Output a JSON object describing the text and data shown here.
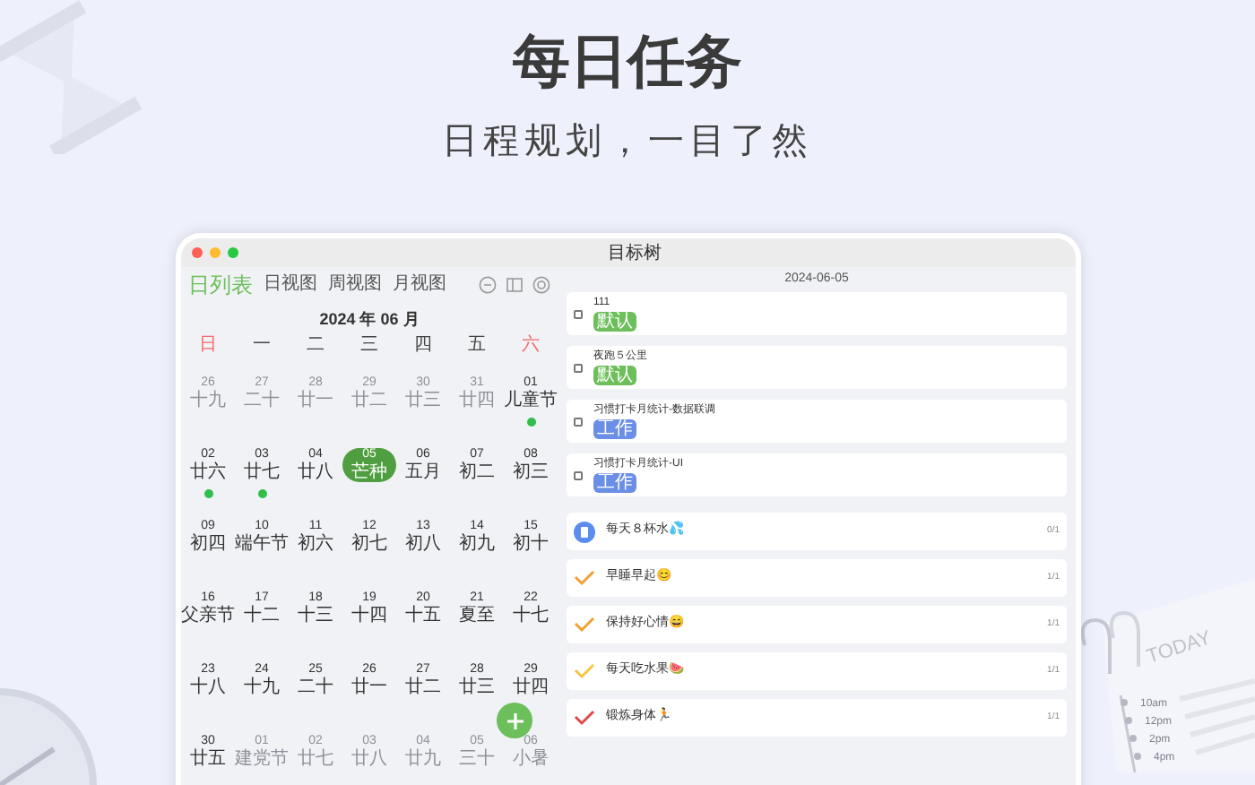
{
  "headline": "每日任务",
  "subtitle": "日程规划，一目了然",
  "window": {
    "title": "目标树"
  },
  "view_tabs": [
    {
      "label": "日列表",
      "selected": true
    },
    {
      "label": "日视图",
      "selected": false
    },
    {
      "label": "周视图",
      "selected": false
    },
    {
      "label": "月视图",
      "selected": false
    }
  ],
  "calendar": {
    "month": "2024 年 06 月",
    "weekdays": [
      {
        "label": "日",
        "weekend": true
      },
      {
        "label": "一",
        "weekend": false
      },
      {
        "label": "二",
        "weekend": false
      },
      {
        "label": "三",
        "weekend": false
      },
      {
        "label": "四",
        "weekend": false
      },
      {
        "label": "五",
        "weekend": false
      },
      {
        "label": "六",
        "weekend": true
      }
    ],
    "weeks": [
      [
        {
          "day": "26",
          "lunar": "十九",
          "in_month": false,
          "selected": false,
          "has_event": false
        },
        {
          "day": "27",
          "lunar": "二十",
          "in_month": false,
          "selected": false,
          "has_event": false
        },
        {
          "day": "28",
          "lunar": "廿一",
          "in_month": false,
          "selected": false,
          "has_event": false
        },
        {
          "day": "29",
          "lunar": "廿二",
          "in_month": false,
          "selected": false,
          "has_event": false
        },
        {
          "day": "30",
          "lunar": "廿三",
          "in_month": false,
          "selected": false,
          "has_event": false
        },
        {
          "day": "31",
          "lunar": "廿四",
          "in_month": false,
          "selected": false,
          "has_event": false
        },
        {
          "day": "01",
          "lunar": "儿童节",
          "in_month": true,
          "selected": false,
          "has_event": true
        }
      ],
      [
        {
          "day": "02",
          "lunar": "廿六",
          "in_month": true,
          "selected": false,
          "has_event": true
        },
        {
          "day": "03",
          "lunar": "廿七",
          "in_month": true,
          "selected": false,
          "has_event": true
        },
        {
          "day": "04",
          "lunar": "廿八",
          "in_month": true,
          "selected": false,
          "has_event": false
        },
        {
          "day": "05",
          "lunar": "芒种",
          "in_month": true,
          "selected": true,
          "has_event": false
        },
        {
          "day": "06",
          "lunar": "五月",
          "in_month": true,
          "selected": false,
          "has_event": false
        },
        {
          "day": "07",
          "lunar": "初二",
          "in_month": true,
          "selected": false,
          "has_event": false
        },
        {
          "day": "08",
          "lunar": "初三",
          "in_month": true,
          "selected": false,
          "has_event": false
        }
      ],
      [
        {
          "day": "09",
          "lunar": "初四",
          "in_month": true,
          "selected": false,
          "has_event": false
        },
        {
          "day": "10",
          "lunar": "端午节",
          "in_month": true,
          "selected": false,
          "has_event": false
        },
        {
          "day": "11",
          "lunar": "初六",
          "in_month": true,
          "selected": false,
          "has_event": false
        },
        {
          "day": "12",
          "lunar": "初七",
          "in_month": true,
          "selected": false,
          "has_event": false
        },
        {
          "day": "13",
          "lunar": "初八",
          "in_month": true,
          "selected": false,
          "has_event": false
        },
        {
          "day": "14",
          "lunar": "初九",
          "in_month": true,
          "selected": false,
          "has_event": false
        },
        {
          "day": "15",
          "lunar": "初十",
          "in_month": true,
          "selected": false,
          "has_event": false
        }
      ],
      [
        {
          "day": "16",
          "lunar": "父亲节",
          "in_month": true,
          "selected": false,
          "has_event": false
        },
        {
          "day": "17",
          "lunar": "十二",
          "in_month": true,
          "selected": false,
          "has_event": false
        },
        {
          "day": "18",
          "lunar": "十三",
          "in_month": true,
          "selected": false,
          "has_event": false
        },
        {
          "day": "19",
          "lunar": "十四",
          "in_month": true,
          "selected": false,
          "has_event": false
        },
        {
          "day": "20",
          "lunar": "十五",
          "in_month": true,
          "selected": false,
          "has_event": false
        },
        {
          "day": "21",
          "lunar": "夏至",
          "in_month": true,
          "selected": false,
          "has_event": false
        },
        {
          "day": "22",
          "lunar": "十七",
          "in_month": true,
          "selected": false,
          "has_event": false
        }
      ],
      [
        {
          "day": "23",
          "lunar": "十八",
          "in_month": true,
          "selected": false,
          "has_event": false
        },
        {
          "day": "24",
          "lunar": "十九",
          "in_month": true,
          "selected": false,
          "has_event": false
        },
        {
          "day": "25",
          "lunar": "二十",
          "in_month": true,
          "selected": false,
          "has_event": false
        },
        {
          "day": "26",
          "lunar": "廿一",
          "in_month": true,
          "selected": false,
          "has_event": false
        },
        {
          "day": "27",
          "lunar": "廿二",
          "in_month": true,
          "selected": false,
          "has_event": false
        },
        {
          "day": "28",
          "lunar": "廿三",
          "in_month": true,
          "selected": false,
          "has_event": false
        },
        {
          "day": "29",
          "lunar": "廿四",
          "in_month": true,
          "selected": false,
          "has_event": false
        }
      ],
      [
        {
          "day": "30",
          "lunar": "廿五",
          "in_month": true,
          "selected": false,
          "has_event": false
        },
        {
          "day": "01",
          "lunar": "建党节",
          "in_month": false,
          "selected": false,
          "has_event": false
        },
        {
          "day": "02",
          "lunar": "廿七",
          "in_month": false,
          "selected": false,
          "has_event": false
        },
        {
          "day": "03",
          "lunar": "廿八",
          "in_month": false,
          "selected": false,
          "has_event": false
        },
        {
          "day": "04",
          "lunar": "廿九",
          "in_month": false,
          "selected": false,
          "has_event": false
        },
        {
          "day": "05",
          "lunar": "三十",
          "in_month": false,
          "selected": false,
          "has_event": false
        },
        {
          "day": "06",
          "lunar": "小暑",
          "in_month": false,
          "selected": false,
          "has_event": false
        }
      ]
    ]
  },
  "day_panel": {
    "date": "2024-06-05",
    "tasks": [
      {
        "title": "111",
        "checked": false,
        "tag": {
          "text": "默认",
          "color": "#6cbf5a"
        }
      },
      {
        "title": "夜跑５公里",
        "checked": false,
        "tag": {
          "text": "默认",
          "color": "#6cbf5a"
        }
      },
      {
        "title": "习惯打卡月统计-数据联调",
        "checked": false,
        "tag": {
          "text": "工作",
          "color": "#6b8fe6"
        }
      },
      {
        "title": "习惯打卡月统计-UI",
        "checked": false,
        "tag": {
          "text": "工作",
          "color": "#6b8fe6"
        }
      }
    ],
    "habits": [
      {
        "kind": "cup",
        "title": "每天８杯水💦",
        "count": "0/1",
        "color": "#5b8def"
      },
      {
        "kind": "check",
        "title": "早睡早起😊",
        "count": "1/1",
        "color": "#f0a030"
      },
      {
        "kind": "check",
        "title": "保持好心情😄",
        "count": "1/1",
        "color": "#f0a030"
      },
      {
        "kind": "check",
        "title": "每天吃水果🍉",
        "count": "1/1",
        "color": "#f5c542"
      },
      {
        "kind": "check",
        "title": "锻炼身体🏃",
        "count": "1/1",
        "color": "#e0484a"
      }
    ]
  },
  "decor": {
    "today_card": {
      "title": "TODAY",
      "times": [
        "10am",
        "12pm",
        "2pm",
        "4pm"
      ]
    }
  }
}
